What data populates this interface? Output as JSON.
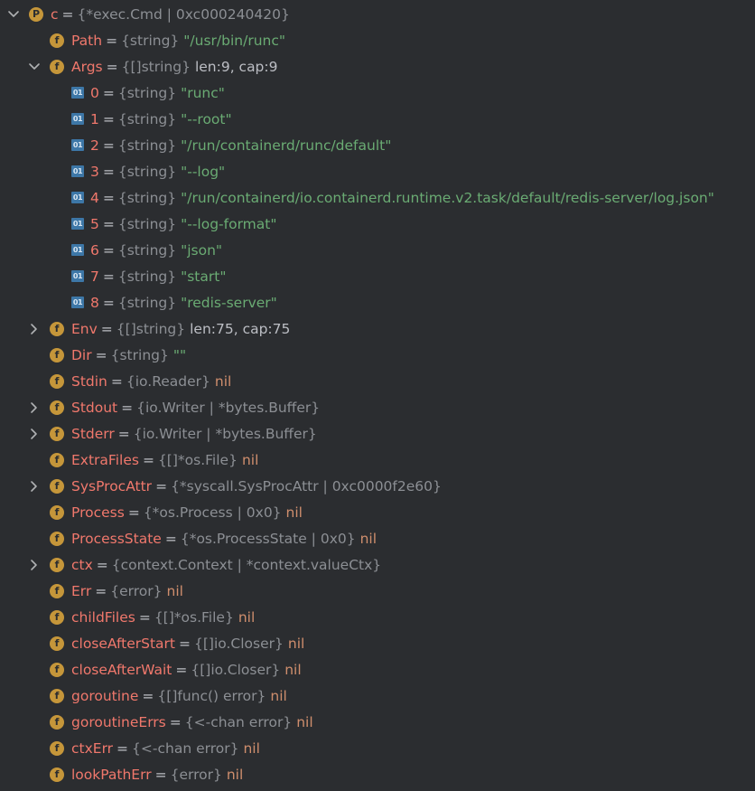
{
  "colors": {
    "background": "#2b2d30",
    "field_name": "#f0786c",
    "type": "#8c8f94",
    "string_value": "#6aab73",
    "nil_keyword": "#cf8e6d",
    "field_icon": "#c5963a",
    "index_icon": "#3d77a7"
  },
  "variables": {
    "rows": [
      {
        "indent": 0,
        "chevron": "expanded",
        "icon": "P",
        "name": "c",
        "type": "{*exec.Cmd | 0xc000240420}",
        "value": "",
        "vclass": "val"
      },
      {
        "indent": 1,
        "chevron": "none",
        "icon": "f",
        "name": "Path",
        "type": "{string}",
        "value": "\"/usr/bin/runc\"",
        "vclass": "str"
      },
      {
        "indent": 1,
        "chevron": "expanded",
        "icon": "f",
        "name": "Args",
        "type": "{[]string}",
        "value": "len:9, cap:9",
        "vclass": "val"
      },
      {
        "indent": 2,
        "chevron": "none",
        "icon": "01",
        "name": "0",
        "type": "{string}",
        "value": "\"runc\"",
        "vclass": "str"
      },
      {
        "indent": 2,
        "chevron": "none",
        "icon": "01",
        "name": "1",
        "type": "{string}",
        "value": "\"--root\"",
        "vclass": "str"
      },
      {
        "indent": 2,
        "chevron": "none",
        "icon": "01",
        "name": "2",
        "type": "{string}",
        "value": "\"/run/containerd/runc/default\"",
        "vclass": "str"
      },
      {
        "indent": 2,
        "chevron": "none",
        "icon": "01",
        "name": "3",
        "type": "{string}",
        "value": "\"--log\"",
        "vclass": "str"
      },
      {
        "indent": 2,
        "chevron": "none",
        "icon": "01",
        "name": "4",
        "type": "{string}",
        "value": "\"/run/containerd/io.containerd.runtime.v2.task/default/redis-server/log.json\"",
        "vclass": "str"
      },
      {
        "indent": 2,
        "chevron": "none",
        "icon": "01",
        "name": "5",
        "type": "{string}",
        "value": "\"--log-format\"",
        "vclass": "str"
      },
      {
        "indent": 2,
        "chevron": "none",
        "icon": "01",
        "name": "6",
        "type": "{string}",
        "value": "\"json\"",
        "vclass": "str"
      },
      {
        "indent": 2,
        "chevron": "none",
        "icon": "01",
        "name": "7",
        "type": "{string}",
        "value": "\"start\"",
        "vclass": "str"
      },
      {
        "indent": 2,
        "chevron": "none",
        "icon": "01",
        "name": "8",
        "type": "{string}",
        "value": "\"redis-server\"",
        "vclass": "str"
      },
      {
        "indent": 1,
        "chevron": "collapsed",
        "icon": "f",
        "name": "Env",
        "type": "{[]string}",
        "value": "len:75, cap:75",
        "vclass": "val"
      },
      {
        "indent": 1,
        "chevron": "none",
        "icon": "f",
        "name": "Dir",
        "type": "{string}",
        "value": "\"\"",
        "vclass": "str"
      },
      {
        "indent": 1,
        "chevron": "none",
        "icon": "f",
        "name": "Stdin",
        "type": "{io.Reader}",
        "value": "nil",
        "vclass": "nil"
      },
      {
        "indent": 1,
        "chevron": "collapsed",
        "icon": "f",
        "name": "Stdout",
        "type": "{io.Writer | *bytes.Buffer}",
        "value": "",
        "vclass": "val"
      },
      {
        "indent": 1,
        "chevron": "collapsed",
        "icon": "f",
        "name": "Stderr",
        "type": "{io.Writer | *bytes.Buffer}",
        "value": "",
        "vclass": "val"
      },
      {
        "indent": 1,
        "chevron": "none",
        "icon": "f",
        "name": "ExtraFiles",
        "type": "{[]*os.File}",
        "value": "nil",
        "vclass": "nil"
      },
      {
        "indent": 1,
        "chevron": "collapsed",
        "icon": "f",
        "name": "SysProcAttr",
        "type": "{*syscall.SysProcAttr | 0xc0000f2e60}",
        "value": "",
        "vclass": "val"
      },
      {
        "indent": 1,
        "chevron": "none",
        "icon": "f",
        "name": "Process",
        "type": "{*os.Process | 0x0}",
        "value": "nil",
        "vclass": "nil"
      },
      {
        "indent": 1,
        "chevron": "none",
        "icon": "f",
        "name": "ProcessState",
        "type": "{*os.ProcessState | 0x0}",
        "value": "nil",
        "vclass": "nil"
      },
      {
        "indent": 1,
        "chevron": "collapsed",
        "icon": "f",
        "name": "ctx",
        "type": "{context.Context | *context.valueCtx}",
        "value": "",
        "vclass": "val"
      },
      {
        "indent": 1,
        "chevron": "none",
        "icon": "f",
        "name": "Err",
        "type": "{error}",
        "value": "nil",
        "vclass": "nil"
      },
      {
        "indent": 1,
        "chevron": "none",
        "icon": "f",
        "name": "childFiles",
        "type": "{[]*os.File}",
        "value": "nil",
        "vclass": "nil"
      },
      {
        "indent": 1,
        "chevron": "none",
        "icon": "f",
        "name": "closeAfterStart",
        "type": "{[]io.Closer}",
        "value": "nil",
        "vclass": "nil"
      },
      {
        "indent": 1,
        "chevron": "none",
        "icon": "f",
        "name": "closeAfterWait",
        "type": "{[]io.Closer}",
        "value": "nil",
        "vclass": "nil"
      },
      {
        "indent": 1,
        "chevron": "none",
        "icon": "f",
        "name": "goroutine",
        "type": "{[]func() error}",
        "value": "nil",
        "vclass": "nil"
      },
      {
        "indent": 1,
        "chevron": "none",
        "icon": "f",
        "name": "goroutineErrs",
        "type": "{<-chan error}",
        "value": "nil",
        "vclass": "nil"
      },
      {
        "indent": 1,
        "chevron": "none",
        "icon": "f",
        "name": "ctxErr",
        "type": "{<-chan error}",
        "value": "nil",
        "vclass": "nil"
      },
      {
        "indent": 1,
        "chevron": "none",
        "icon": "f",
        "name": "lookPathErr",
        "type": "{error}",
        "value": "nil",
        "vclass": "nil"
      }
    ]
  }
}
